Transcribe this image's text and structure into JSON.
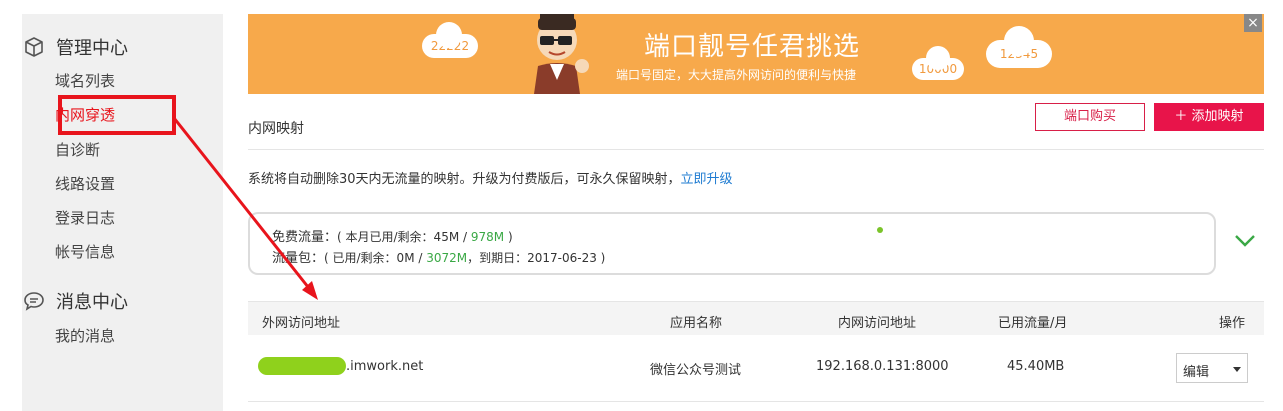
{
  "sidebar": {
    "admin_section": "管理中心",
    "items": [
      {
        "label": "域名列表"
      },
      {
        "label": "内网穿透"
      },
      {
        "label": "自诊断"
      },
      {
        "label": "线路设置"
      },
      {
        "label": "登录日志"
      },
      {
        "label": "帐号信息"
      }
    ],
    "message_section": "消息中心",
    "message_items": [
      {
        "label": "我的消息"
      }
    ]
  },
  "banner": {
    "title": "端口靓号任君挑选",
    "subtitle": "端口号固定，大大提高外网访问的便利与快捷",
    "cloud_numbers": [
      "22222",
      "10000",
      "12345"
    ],
    "close_label": "×"
  },
  "mapping": {
    "title": "内网映射",
    "buy_label": "端口购买",
    "add_label": "＋ 添加映射",
    "notice_text": "系统将自动删除30天内无流量的映射。升级为付费版后，可永久保留映射，",
    "notice_link": "立即升级"
  },
  "quota": {
    "free_label": "免费流量：",
    "free_detail_pre": "( 本月已用/剩余：45M / ",
    "free_total": "978M",
    "free_detail_post": " )",
    "pack_label": "流量包：",
    "pack_detail_pre": "( 已用/剩余：0M / ",
    "pack_total": "3072M",
    "pack_detail_post": "，到期日：2017-06-23 )"
  },
  "table": {
    "headers": [
      "外网访问地址",
      "应用名称",
      "内网访问地址",
      "已用流量/月",
      "操作"
    ],
    "rows": [
      {
        "external_suffix": ".imwork.net",
        "app_name": "微信公众号测试",
        "internal_addr": "192.168.0.131:8000",
        "traffic": "45.40MB",
        "action": "编辑"
      }
    ]
  },
  "colors": {
    "accent": "#e8144a",
    "banner": "#f7a94b",
    "link": "#1e7bd1",
    "green": "#3aa845",
    "highlight": "#e8141c"
  }
}
